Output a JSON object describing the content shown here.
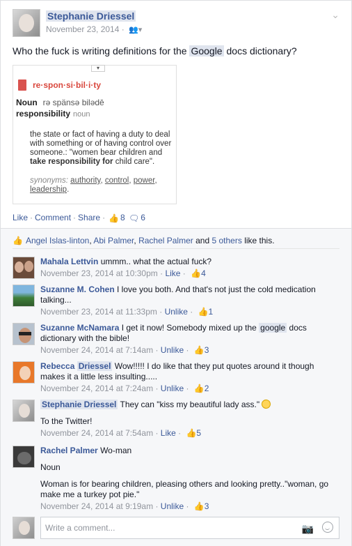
{
  "post": {
    "author": "Stephanie Driessel",
    "date": "November 23, 2014",
    "text_before": "Who the fuck is writing definitions for the ",
    "text_highlight": "Google",
    "text_after": " docs dictionary?"
  },
  "dictionary": {
    "toggle": "▾",
    "word": "re·spon·si·bil·i·ty",
    "pos": "Noun",
    "pronunciation": "rə spänsə bilədē",
    "headword": "responsibility",
    "headword_pos": "noun",
    "definition_start": "the state or fact of having a duty to deal with something or of having control over someone.: \"women bear children and ",
    "definition_bold": "take responsibility for",
    "definition_end": " child care\".",
    "synonyms_label": "synonyms:",
    "synonyms": [
      "authority",
      "control",
      "power",
      "leadership"
    ]
  },
  "actions": {
    "like": "Like",
    "comment": "Comment",
    "share": "Share",
    "likes_count": "8",
    "comments_count": "6"
  },
  "likes_bar": {
    "names": [
      "Angel Islas-linton",
      "Abi Palmer",
      "Rachel Palmer"
    ],
    "and": "and",
    "others": "5 others",
    "suffix": "like this."
  },
  "comments": [
    {
      "name": "Mahala Lettvin",
      "text": "ummm.. what the actual fuck?",
      "time": "November 23, 2014 at 10:30pm",
      "action": "Like",
      "likes": "4"
    },
    {
      "name": "Suzanne M. Cohen",
      "text": "I love you both. And that's not just the cold medication talking...",
      "time": "November 23, 2014 at 11:33pm",
      "action": "Unlike",
      "likes": "1"
    },
    {
      "name": "Suzanne McNamara",
      "text_before": "I get it now! Somebody mixed up the ",
      "text_highlight": "google",
      "text_after": " docs dictionary with the bible!",
      "time": "November 24, 2014 at 7:14am",
      "action": "Unlike",
      "likes": "3"
    },
    {
      "name_first": "Rebecca",
      "name_last": "Driessel",
      "text": "Wow!!!!! I do like that they put quotes around it though makes it a little less insulting.....",
      "time": "November 24, 2014 at 7:24am",
      "action": "Unlike",
      "likes": "2"
    },
    {
      "name": "Stephanie Driessel",
      "text": "They can \"kiss my beautiful lady ass.\"",
      "text2": "To the Twitter!",
      "time": "November 24, 2014 at 7:54am",
      "action": "Like",
      "likes": "5"
    },
    {
      "name": "Rachel Palmer",
      "text": "Wo-man",
      "text2": "Noun",
      "text3": "Woman is for bearing children, pleasing others and looking pretty..\"woman, go make me a turkey pot pie.\"",
      "time": "November 24, 2014 at 9:19am",
      "action": "Unlike",
      "likes": "3"
    }
  ],
  "composer": {
    "placeholder": "Write a comment..."
  },
  "icons": {
    "thumb": "👍",
    "speech": "💬"
  }
}
